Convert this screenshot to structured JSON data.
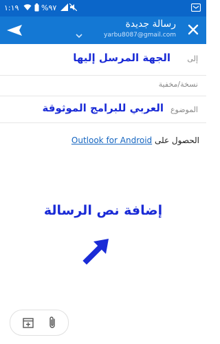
{
  "status_bar": {
    "time": "١:١٩",
    "battery": "%٩٧"
  },
  "header": {
    "title": "رسالة جديدة",
    "account": "yarbu8087@gmail.com",
    "close_icon": "close-icon",
    "send_icon": "send-icon"
  },
  "compose": {
    "to_label": "إلى",
    "to_value": "الجهة المرسل إليها",
    "cc_label": "نسخة/مخفية",
    "subject_label": "الموضوع",
    "subject_value": "العربي للبرامج الموثوقة"
  },
  "signature": {
    "prefix": "الحصول على",
    "link": "Outlook for Android"
  },
  "body": {
    "text": "إضافة نص الرسالة"
  },
  "toolbar": {
    "items": [
      "calendar-add-icon",
      "attach-icon"
    ]
  },
  "colors": {
    "header": "#1478d4",
    "status_bar": "#0b66c9",
    "annotation": "#1a2bd6",
    "link": "#1565c0"
  }
}
